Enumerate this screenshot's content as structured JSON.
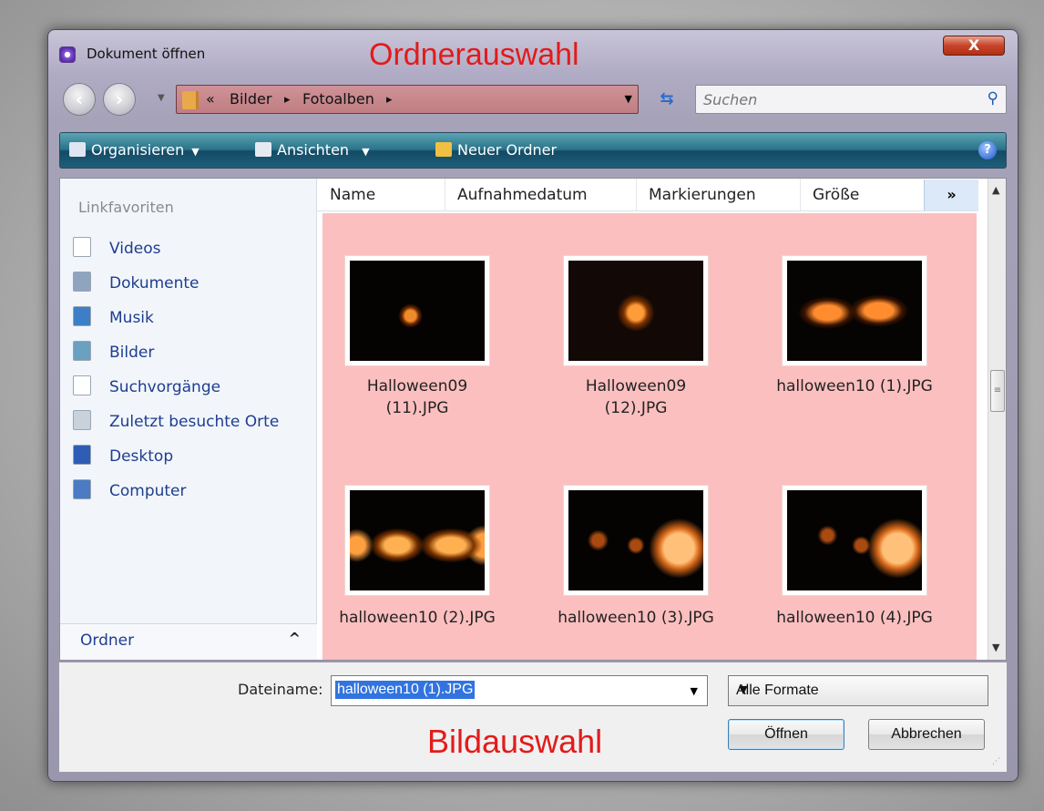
{
  "window": {
    "title": "Dokument öffnen",
    "close_label": "X",
    "annotation_top": "Ordnerauswahl",
    "annotation_bottom": "Bildauswahl"
  },
  "navigation": {
    "back_icon": "back-arrow-icon",
    "forward_icon": "forward-arrow-icon",
    "breadcrumb": [
      "«",
      "Bilder",
      "▸",
      "Fotoalben",
      "▸"
    ],
    "search_placeholder": "Suchen"
  },
  "toolbar": {
    "organize_label": "Organisieren",
    "views_label": "Ansichten",
    "new_folder_label": "Neuer Ordner",
    "help_label": "?"
  },
  "sidebar": {
    "header": "Linkfavoriten",
    "items": [
      {
        "label": "Videos",
        "icon": "video-doc-icon"
      },
      {
        "label": "Dokumente",
        "icon": "documents-icon"
      },
      {
        "label": "Musik",
        "icon": "music-icon"
      },
      {
        "label": "Bilder",
        "icon": "pictures-icon"
      },
      {
        "label": "Suchvorgänge",
        "icon": "search-doc-icon"
      },
      {
        "label": "Zuletzt besuchte Orte",
        "icon": "recent-places-icon"
      },
      {
        "label": "Desktop",
        "icon": "desktop-icon"
      },
      {
        "label": "Computer",
        "icon": "computer-icon"
      }
    ],
    "folder_toggle": "Ordner",
    "folder_toggle_arrow": "^"
  },
  "columns": [
    "Name",
    "Aufnahmedatum",
    "Markierungen",
    "Größe",
    "»"
  ],
  "files": [
    {
      "name": "Halloween09\n(11).JPG"
    },
    {
      "name": "Halloween09\n(12).JPG"
    },
    {
      "name": "halloween10 (1).JPG"
    },
    {
      "name": "halloween10 (2).JPG"
    },
    {
      "name": "halloween10 (3).JPG"
    },
    {
      "name": "halloween10 (4).JPG"
    }
  ],
  "footer": {
    "filename_label": "Dateiname:",
    "filename_value": "halloween10 (1).JPG",
    "filetype_value": "Alle Formate",
    "open_label": "Öffnen",
    "cancel_label": "Abbrechen"
  },
  "colors": {
    "annotation": "#e21b1b",
    "file_area": "#fcbfbf",
    "toolbar": "#2a7288",
    "link": "#1e3d8f"
  }
}
